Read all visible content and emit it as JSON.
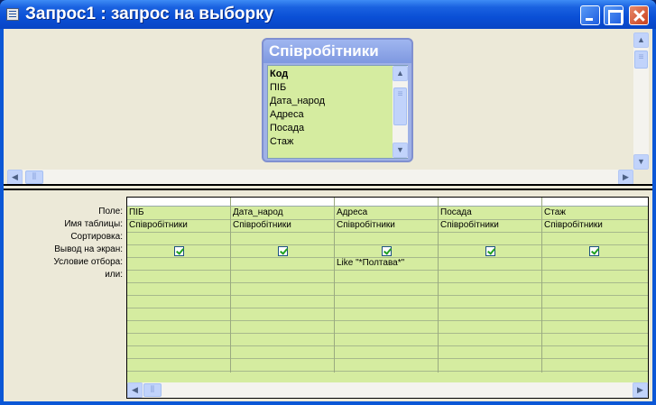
{
  "window": {
    "title": "Запрос1 : запрос на выборку",
    "icons": {
      "app": "query-icon",
      "minimize": "minimize-icon",
      "maximize": "maximize-icon",
      "close": "close-icon"
    }
  },
  "table": {
    "name": "Співробітники",
    "fields": [
      {
        "label": "Код",
        "primary_key": true
      },
      {
        "label": "ПІБ",
        "primary_key": false
      },
      {
        "label": "Дата_народ",
        "primary_key": false
      },
      {
        "label": "Адреса",
        "primary_key": false
      },
      {
        "label": "Посада",
        "primary_key": false
      },
      {
        "label": "Стаж",
        "primary_key": false
      }
    ]
  },
  "grid": {
    "row_labels": {
      "field": "Поле:",
      "table": "Имя таблицы:",
      "sort": "Сортировка:",
      "show": "Вывод на экран:",
      "criteria": "Условие отбора:",
      "or": "или:"
    },
    "columns": [
      {
        "field": "ПІБ",
        "table": "Співробітники",
        "sort": "",
        "show": true,
        "criteria": "",
        "or": ""
      },
      {
        "field": "Дата_народ",
        "table": "Співробітники",
        "sort": "",
        "show": true,
        "criteria": "",
        "or": ""
      },
      {
        "field": "Адреса",
        "table": "Співробітники",
        "sort": "",
        "show": true,
        "criteria": "Like \"*Полтава*\"",
        "or": ""
      },
      {
        "field": "Посада",
        "table": "Співробітники",
        "sort": "",
        "show": true,
        "criteria": "",
        "or": ""
      },
      {
        "field": "Стаж",
        "table": "Співробітники",
        "sort": "",
        "show": true,
        "criteria": "",
        "or": ""
      }
    ]
  },
  "colors": {
    "titlebar": "#0a4fd6",
    "grid_background": "#d5eca0",
    "table_header": "#8aa2e8",
    "window_background": "#ece9d8"
  }
}
